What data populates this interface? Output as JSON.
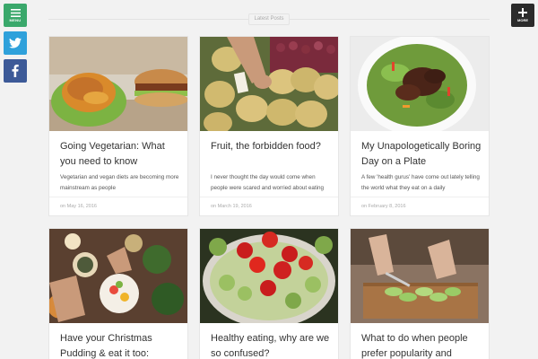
{
  "sidebar": {
    "menu_label": "MENU",
    "more_label": "MORE"
  },
  "section_label": "Latest Posts",
  "posts": [
    {
      "title": "Going Vegetarian: What you need to know",
      "excerpt": "Vegetarian and vegan diets are becoming more mainstream as people",
      "date": "on May 16, 2016"
    },
    {
      "title": "Fruit, the forbidden food?",
      "excerpt": "I never thought the day would come when people were scared and worried about eating fruit. And I'm not talking",
      "date": "on March 19, 2016"
    },
    {
      "title": "My Unapologetically Boring Day on a Plate",
      "excerpt": "A few 'health gurus' have come out lately telling the world what they eat on a daily",
      "date": "on February 8, 2016"
    },
    {
      "title": "Have your Christmas Pudding & eat it too:"
    },
    {
      "title": "Healthy eating, why are we so confused?"
    },
    {
      "title": "What to do when people prefer popularity and"
    }
  ],
  "colors": {
    "menu": "#3aa86b",
    "twitter": "#2fa1db",
    "facebook": "#3d5a98",
    "more": "#2b2b2b"
  }
}
